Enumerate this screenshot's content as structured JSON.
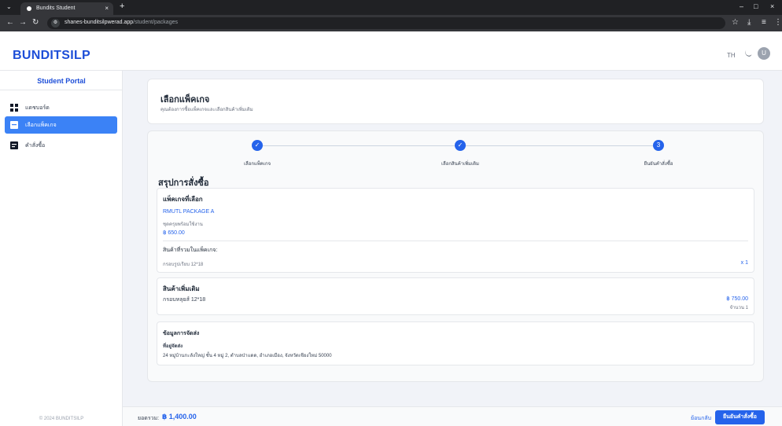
{
  "browser": {
    "tab_title": "Bundits Student",
    "tab_close": "×",
    "new_tab": "+",
    "url_host": "shanes-bunditsilpwerad.app",
    "url_path": "/student/packages",
    "win_min": "–",
    "win_max": "□",
    "win_close": "×"
  },
  "header": {
    "brand": "BUNDITSILP",
    "lang": "TH"
  },
  "sidebar": {
    "title": "Student Portal",
    "items": [
      {
        "label": "แดชบอร์ด"
      },
      {
        "label": "เลือกแพ็คเกจ"
      },
      {
        "label": "คำสั่งซื้อ"
      }
    ],
    "copyright": "© 2024 BUNDITSILP"
  },
  "page": {
    "title": "เลือกแพ็คเกจ",
    "subtitle": "คุณต้องการซื้อแพ็คเกจและเลือกสินค้าเพิ่มเติม"
  },
  "steps": [
    {
      "icon": "✓",
      "label": "เลือกแพ็คเกจ"
    },
    {
      "icon": "✓",
      "label": "เลือกสินค้าเพิ่มเติม"
    },
    {
      "icon": "3",
      "label": "ยืนยันคำสั่งซื้อ"
    }
  ],
  "summary": {
    "title": "สรุปการสั่งซื้อ",
    "package": {
      "heading": "แพ็คเกจที่เลือก",
      "name": "RMUTL PACKAGE A",
      "desc": "ชุดครุยพร้อมใช้งาน",
      "price": "฿ 650.00",
      "included_heading": "สินค้าที่รวมในแพ็คเกจ:",
      "included_item": "กรอบรูปเรียบ 12*18",
      "included_qty": "x 1"
    },
    "extra": {
      "heading": "สินค้าเพิ่มเติม",
      "item": "กรอบหลุยส์ 12*18",
      "price": "฿ 750.00",
      "qty": "จำนวน 1"
    },
    "shipping": {
      "heading": "ข้อมูลการจัดส่ง",
      "address_label": "ที่อยู่จัดส่ง",
      "address": "24 หมู่บ้านกะลังใหญ่ ชั้น 4 หมู่ 2, ตำบลป่าแดด, อำเภอเมือง, จังหวัดเชียงใหม่ 50000"
    }
  },
  "footer": {
    "total_label": "ยอดรวม:",
    "total_value": "฿ 1,400.00",
    "back": "ย้อนกลับ",
    "confirm": "ยืนยันคำสั่งซื้อ"
  }
}
